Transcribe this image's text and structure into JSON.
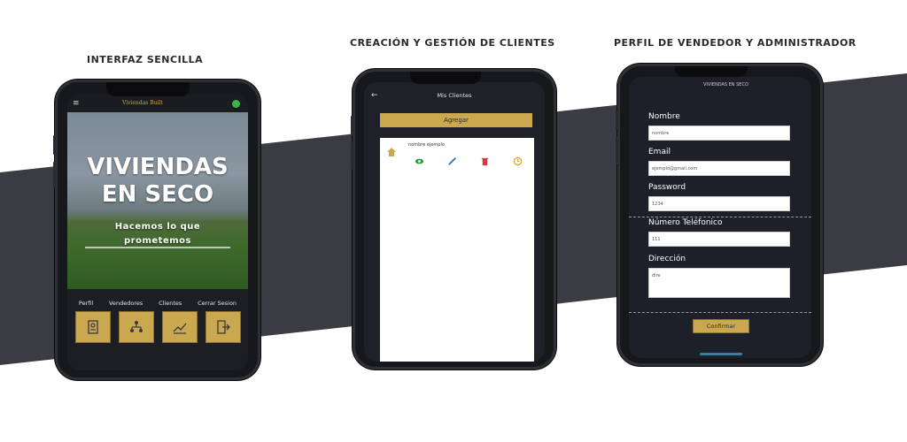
{
  "captions": {
    "left": "INTERFAZ SENCILLA",
    "center": "CREACIÓN Y GESTIÓN DE CLIENTES",
    "right": "PERFIL DE VENDEDOR Y ADMINISTRADOR"
  },
  "phone1": {
    "menu_icon": "≡",
    "logo_text": "Viviendas Built",
    "hero_title_line1": "VIVIENDAS",
    "hero_title_line2": "EN SECO",
    "hero_subtitle_line1": "Hacemos lo que",
    "hero_subtitle_line2": "prometemos",
    "nav": [
      {
        "label": "Perfil",
        "icon": "profile-icon"
      },
      {
        "label": "Vendedores",
        "icon": "sellers-icon"
      },
      {
        "label": "Clientes",
        "icon": "clients-icon"
      },
      {
        "label": "Cerrar Sesion",
        "icon": "logout-icon"
      }
    ]
  },
  "phone2": {
    "back_icon": "←",
    "title": "Mis Clientes",
    "add_button": "Agregar",
    "client_name": "nombre ejemplo"
  },
  "phone3": {
    "logo_text": "VIVIENDAS EN SECO",
    "fields": [
      {
        "label": "Nombre",
        "value": "nombre"
      },
      {
        "label": "Email",
        "value": "ejemplo@gmail.com"
      },
      {
        "label": "Password",
        "value": "1234"
      },
      {
        "label": "Número Teléfonico",
        "value": "111"
      },
      {
        "label": "Dirección",
        "value": "dire"
      }
    ],
    "confirm_button": "Confirmar"
  },
  "colors": {
    "gold": "#c9a84f",
    "phone_body": "#17181c",
    "screen_dark": "#1d1f29",
    "band": "#3b3c43"
  }
}
